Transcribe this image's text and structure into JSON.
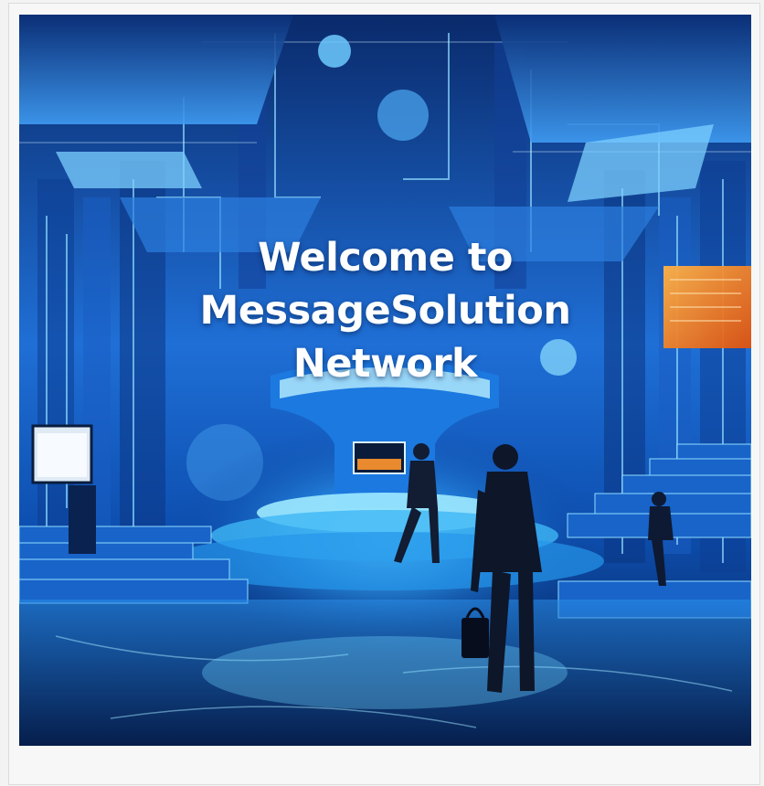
{
  "hero": {
    "image_alt": "Futuristic blue data center hall with two businessmen walking",
    "headline_lines": [
      "Welcome to",
      "MessageSolution",
      "Network"
    ]
  },
  "colors": {
    "page_background": "#f3f3f3",
    "frame_background": "#f7f7f7",
    "scene_dark": "#06163a",
    "scene_blue": "#1f6fd6",
    "scene_glow": "#5fd3ff",
    "accent_orange": "#ff7a1a",
    "headline_text": "#ffffff"
  },
  "icons": {
    "monitor": "monitor-icon",
    "briefcase": "briefcase-icon"
  }
}
